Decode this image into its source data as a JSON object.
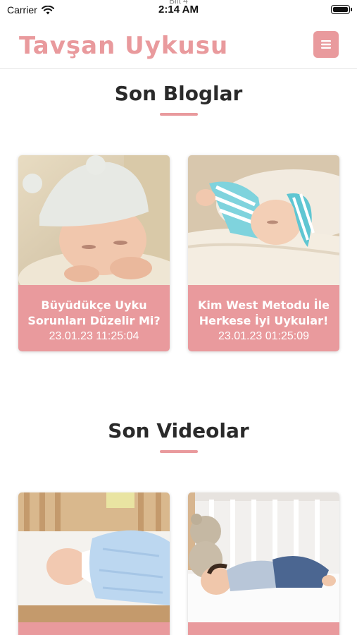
{
  "status_bar": {
    "carrier": "Carrier",
    "time": "2:14 AM",
    "sub_label": "Bilt 4"
  },
  "header": {
    "brand": "Tavşan Uykusu"
  },
  "blogs": {
    "title": "Son Bloglar",
    "items": [
      {
        "title": "Büyüdükçe Uyku Sorunları Düzelir Mi?",
        "date": "23.01.23 11:25:04"
      },
      {
        "title": "Kim West Metodu İle Herkese İyi Uykular!",
        "date": "23.01.23 01:25:09"
      }
    ]
  },
  "videos": {
    "title": "Son Videolar"
  },
  "colors": {
    "accent": "#e99a9d",
    "heading": "#2a2a2a"
  }
}
